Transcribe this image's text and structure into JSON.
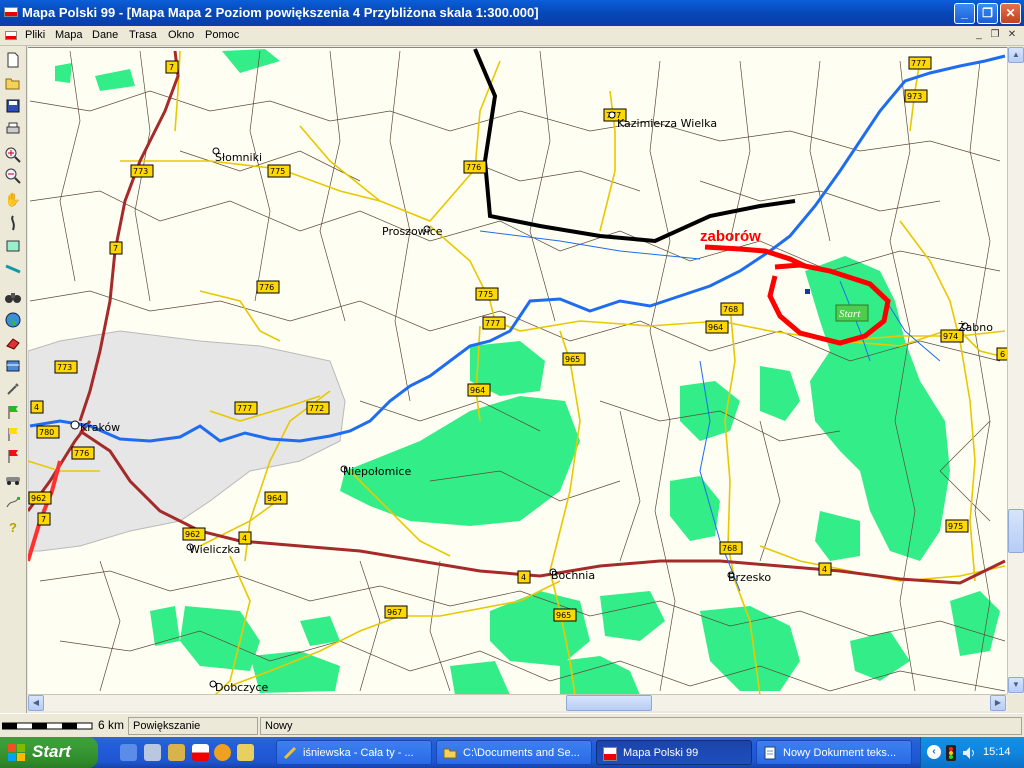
{
  "window": {
    "title": "Mapa Polski 99 - [Mapa Mapa 2 Poziom powiększenia 4 Przybliżona skala 1:300.000]"
  },
  "menu": [
    "Pliki",
    "Mapa",
    "Dane",
    "Trasa",
    "Okno",
    "Pomoc"
  ],
  "toolbar_icons": [
    "new-file-icon",
    "open-folder-icon",
    "save-icon",
    "print-icon",
    "zoom-in-icon",
    "zoom-out-icon",
    "hand-pan-icon",
    "route-icon",
    "layers-icon",
    "measure-icon",
    "binoculars-icon",
    "globe-icon",
    "eraser-icon",
    "database-icon",
    "tools-icon",
    "flag-green-icon",
    "flag-yellow-icon",
    "flag-red-icon",
    "car-icon",
    "route-flags-icon",
    "help-icon"
  ],
  "map": {
    "towns": [
      "Kazimierza Wielka",
      "Słomniki",
      "Proszowice",
      "Kraków",
      "Niepołomice",
      "Wieliczka",
      "Bochnia",
      "Brzesko",
      "Żabno",
      "Dobczyce"
    ],
    "road_numbers": [
      "7",
      "773",
      "775",
      "776",
      "777",
      "772",
      "780",
      "962",
      "964",
      "965",
      "967",
      "768",
      "4",
      "974",
      "975",
      "973",
      "6"
    ],
    "annotation_text": "zaborów",
    "start_marker": "Start"
  },
  "status": {
    "scale_label": "6 km",
    "mode": "Powiększanie",
    "info": "Nowy"
  },
  "taskbar": {
    "start_label": "Start",
    "tasks": [
      {
        "label": "iśniewska - Cała ty - ..."
      },
      {
        "label": "C:\\Documents and Se..."
      },
      {
        "label": "Mapa Polski 99"
      },
      {
        "label": "Nowy Dokument teks..."
      }
    ],
    "clock": "15:14"
  },
  "colors": {
    "map_background": "#fffef2",
    "forest": "#33ee88",
    "river": "#1e6cf0",
    "main_road": "#a52a2a",
    "annotation": "#ff0000"
  }
}
